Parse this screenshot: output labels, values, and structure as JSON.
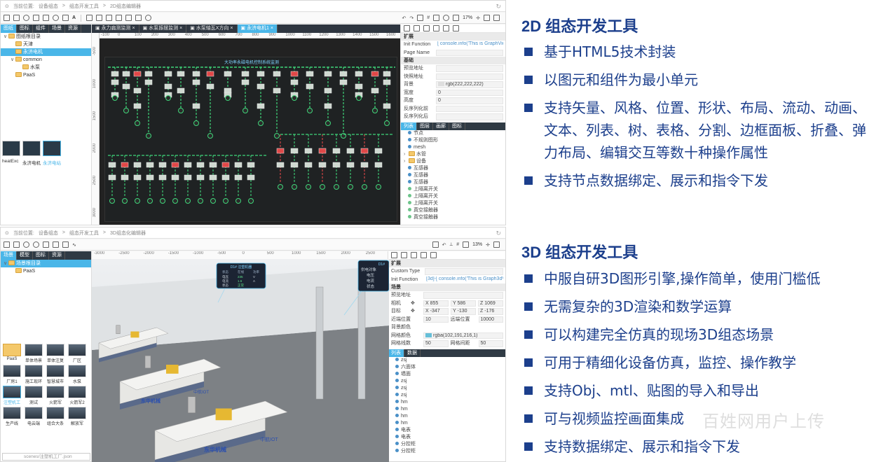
{
  "colors": {
    "accent": "#4ab6e8",
    "title_blue": "#1c3f8c",
    "canvas_dark": "#1f2223",
    "flow_green": "#3fd67a",
    "alarm_red": "#e04848"
  },
  "panel2d": {
    "breadcrumb": [
      "当前位置:",
      "设备组态",
      ">",
      "组态开发工具",
      ">",
      "2D组态编辑器"
    ],
    "side_tabs": [
      "图纸",
      "图标",
      "组件",
      "场景",
      "资源"
    ],
    "tree": [
      {
        "label": "图纸根目录",
        "level": 0,
        "expanded": true
      },
      {
        "label": "天津",
        "level": 1
      },
      {
        "label": "永济电机",
        "level": 1,
        "selected": true
      },
      {
        "label": "common",
        "level": 1,
        "expanded": true
      },
      {
        "label": "水泵",
        "level": 2
      },
      {
        "label": "PaaS",
        "level": 1
      }
    ],
    "thumbnails": [
      "heatExc",
      "永济电机",
      "永济电站"
    ],
    "doc_tabs": [
      "永力扁测监测",
      "水泵振摆监测",
      "水泵轴瓦X方向",
      "永济电机1"
    ],
    "ruler_ticks": [
      "-100",
      "0",
      "100",
      "200",
      "300",
      "400",
      "500",
      "600",
      "700",
      "800",
      "900",
      "1000",
      "1100",
      "1200",
      "1300",
      "1400",
      "1500",
      "1600"
    ],
    "vruler_ticks": [
      "-500",
      "1000",
      "1500",
      "2000",
      "2500",
      "3000"
    ],
    "zoom": "17%",
    "diagram_title": "大功率永磁电机控制系统监测",
    "props": {
      "section_expand": "扩展",
      "init_function_key": "Init Function",
      "init_function_val": "[ console.info('This is GraphView in",
      "page_name_key": "Page Name",
      "section_basic": "基础",
      "rows": [
        {
          "k": "预览地址",
          "v": ""
        },
        {
          "k": "快照地址",
          "v": ""
        },
        {
          "k": "背景",
          "v": "rgb(222,222,222)"
        },
        {
          "k": "宽度",
          "v": "0"
        },
        {
          "k": "高度",
          "v": "0"
        },
        {
          "k": "反序列化前",
          "v": ""
        },
        {
          "k": "反序列化后",
          "v": ""
        }
      ],
      "list_tabs": [
        "列表",
        "图层",
        "画廊",
        "图标"
      ],
      "list": [
        {
          "label": "节点",
          "type": "item"
        },
        {
          "label": "不规则图形",
          "type": "item"
        },
        {
          "label": "mesh",
          "type": "item"
        },
        {
          "label": "水管",
          "type": "folder"
        },
        {
          "label": "设备",
          "type": "folder"
        },
        {
          "label": "互感器",
          "type": "item"
        },
        {
          "label": "互感器",
          "type": "item"
        },
        {
          "label": "互感器",
          "type": "item"
        },
        {
          "label": "上隔离开关",
          "type": "dot"
        },
        {
          "label": "上隔离开关",
          "type": "dot"
        },
        {
          "label": "上隔离开关",
          "type": "dot"
        },
        {
          "label": "真空接触器",
          "type": "dot"
        },
        {
          "label": "真空接触器",
          "type": "dot"
        }
      ]
    }
  },
  "panel3d": {
    "breadcrumb": [
      "当前位置:",
      "设备组态",
      ">",
      "组态开发工具",
      ">",
      "3D组态化编辑器"
    ],
    "side_tabs": [
      "场景",
      "模型",
      "图标",
      "资源"
    ],
    "tree": [
      {
        "label": "场景根目录",
        "level": 0,
        "selected": true
      },
      {
        "label": "PaaS",
        "level": 1
      }
    ],
    "assets": [
      {
        "label": "PaaS",
        "folder": true
      },
      {
        "label": "单体场景"
      },
      {
        "label": "单体注复"
      },
      {
        "label": "厂区"
      },
      {
        "label": "厂房1"
      },
      {
        "label": "施工现环"
      },
      {
        "label": "智慧城市"
      },
      {
        "label": "水泵"
      },
      {
        "label": "注塑机工",
        "selected": true
      },
      {
        "label": "测试"
      },
      {
        "label": "火箭军"
      },
      {
        "label": "火箭军2"
      },
      {
        "label": "生产线"
      },
      {
        "label": "电云端"
      },
      {
        "label": "组合大条"
      },
      {
        "label": "解放军"
      }
    ],
    "path": "scenes/注塑机工厂.json",
    "ruler_ticks": [
      "-3000",
      "-2500",
      "-2000",
      "-1500",
      "-1000",
      "-500",
      "0",
      "500",
      "1000",
      "1500",
      "2000",
      "2500"
    ],
    "zoom": "13%",
    "popup": {
      "title": "D1# 注塑机器",
      "cols": [
        "状态",
        "在线",
        "功率"
      ],
      "rows": [
        [
          "电压",
          "235",
          "V"
        ],
        [
          "电流",
          "1.6",
          "A"
        ],
        [
          "状态",
          "正常",
          ""
        ]
      ]
    },
    "popup2": {
      "title": "D1#",
      "lines": [
        "供电对象",
        "电压",
        "电流",
        "状态"
      ]
    },
    "machine_brand": "东华机械",
    "machine_model": "中航IOT",
    "props": {
      "section_expand": "扩展",
      "custom_type_key": "Custom Type",
      "init_function_key": "Init Function",
      "init_function_val": "[3d]-[ console.info('This is Graph3dView in",
      "section_scene": "场景",
      "preview_key": "预览地址",
      "camera_key": "相机",
      "camera": {
        "x": "855",
        "y": "586",
        "z": "1069"
      },
      "target_key": "目标",
      "target": {
        "x": "-347",
        "y": "-130",
        "z": "-176"
      },
      "near_key": "近端位置",
      "near": "10",
      "far_key": "远端位置",
      "far": "10000",
      "bgcolor_key": "背景颜色",
      "gridcolor_key": "网格颜色",
      "gridcolor": "rgba(102,191,216,1)",
      "gridcount_key": "网格线数",
      "gridcount": "50",
      "gridgap_key": "网格间距",
      "gridgap": "50",
      "list_tabs": [
        "列表",
        "数据"
      ],
      "list": [
        "zsj",
        "六面体",
        "墙面",
        "zsj",
        "zsj",
        "zsj",
        "hm",
        "hm",
        "hm",
        "hm",
        "电表",
        "电表",
        "分控柜",
        "分控柜"
      ]
    }
  },
  "text": {
    "title2d": "2D 组态开发工具",
    "bullets2d": [
      "基于HTML5技术封装",
      "以图元和组件为最小单元",
      "支持矢量、风格、位置、形状、布局、流动、动画、文本、列表、树、表格、分割、边框面板、折叠、弹力布局、编辑交互等数十种操作属性",
      "支持节点数据绑定、展示和指令下发"
    ],
    "title3d": "3D 组态开发工具",
    "bullets3d": [
      "中服自研3D图形引擎,操作简单，使用门槛低",
      "无需复杂的3D渲染和数学运算",
      "可以构建完全仿真的现场3D组态场景",
      "可用于精细化设备仿真，监控、操作教学",
      "支持Obj、mtl、贴图的导入和导出",
      "可与视频监控画面集成",
      "支持数据绑定、展示和指令下发"
    ],
    "watermark": "百姓网用户上传"
  }
}
